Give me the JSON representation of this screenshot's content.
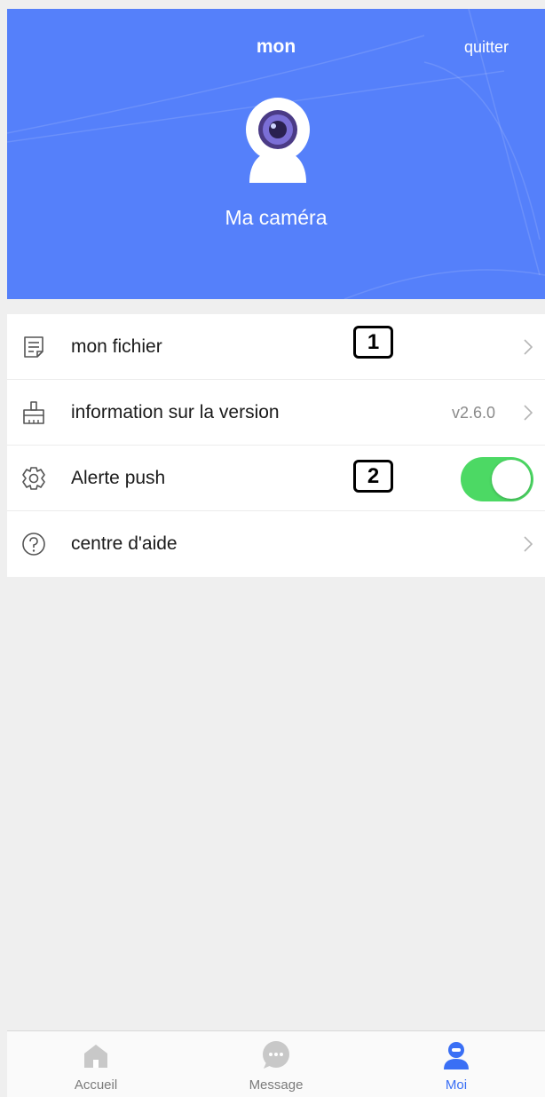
{
  "header": {
    "title": "mon",
    "quit_label": "quitter",
    "camera_name": "Ma caméra",
    "background_color": "#5580fa"
  },
  "menu": {
    "items": [
      {
        "label": "mon fichier",
        "icon": "document-icon",
        "marker": "1"
      },
      {
        "label": "information sur la version",
        "icon": "broom-icon",
        "value": "v2.6.0"
      },
      {
        "label": "Alerte push",
        "icon": "gear-icon",
        "marker": "2",
        "toggle_on": true,
        "toggle_color": "#4cd964"
      },
      {
        "label": "centre d'aide",
        "icon": "help-circle-icon"
      }
    ]
  },
  "tabbar": {
    "tabs": [
      {
        "label": "Accueil",
        "icon": "home-icon",
        "active": false
      },
      {
        "label": "Message",
        "icon": "chat-bubble-icon",
        "active": false
      },
      {
        "label": "Moi",
        "icon": "user-icon",
        "active": true
      }
    ],
    "active_color": "#3a6ff5",
    "inactive_color": "#c8c8c8"
  }
}
